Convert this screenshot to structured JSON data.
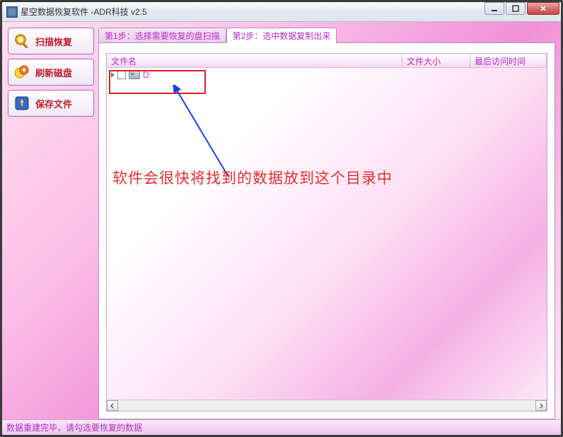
{
  "window": {
    "title": "星空数据恢复软件   -ADR科技 v2.5"
  },
  "sidebar": {
    "scan": "扫描恢复",
    "refresh": "刷新磁盘",
    "save": "保存文件"
  },
  "tabs": {
    "step1": "第1步：选择需要恢复的盘扫描",
    "step2": "第2步：选中数据复制出来"
  },
  "grid": {
    "col_name": "文件名",
    "col_size": "文件大小",
    "col_time": "最后访问时间"
  },
  "tree": {
    "root_label": "D:"
  },
  "annotation": {
    "text": "软件会很快将找到的数据放到这个目录中"
  },
  "status": {
    "text": "数据重建完毕，请勾选要恢复的数据"
  }
}
